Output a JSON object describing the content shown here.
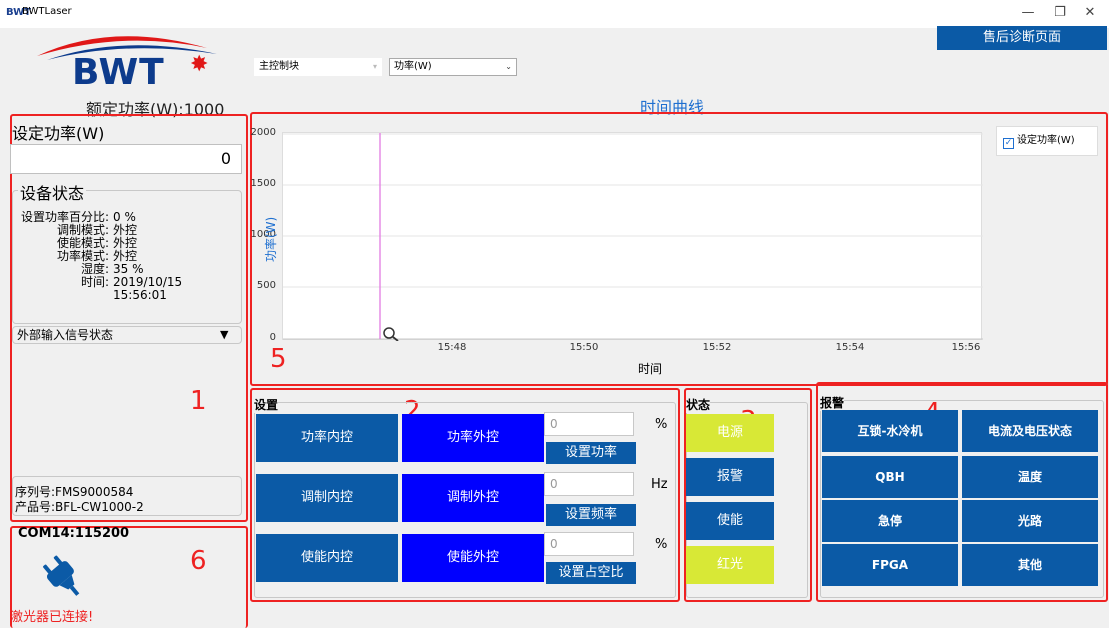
{
  "titlebar": {
    "app_name": "BWTLaser",
    "icon_text": "BWT",
    "minimize": "—",
    "restore": "❐",
    "close": "✕"
  },
  "header": {
    "service_button": "售后诊断页面",
    "logo_text": "BWT",
    "rated_power": "额定功率(W):1000",
    "module_combo": "主控制块",
    "param_combo": "功率(W)"
  },
  "left_panel": {
    "set_power_label": "设定功率(W)",
    "set_power_value": "0",
    "status_group_title": "设备状态",
    "status_items": [
      {
        "label": "设置功率百分比:",
        "value": "0 %"
      },
      {
        "label": "调制模式:",
        "value": "外控"
      },
      {
        "label": "使能模式:",
        "value": "外控"
      },
      {
        "label": "功率模式:",
        "value": "外控"
      },
      {
        "label": "湿度:",
        "value": "35 %"
      },
      {
        "label": "时间:",
        "value": "2019/10/15"
      },
      {
        "label": "",
        "value": "15:56:01"
      }
    ],
    "ext_signal": "外部输入信号状态",
    "serial_no": "序列号:FMS9000584",
    "product_no": "产品号:BFL-CW1000-2"
  },
  "connection": {
    "com": "COM14:115200",
    "status": "激光器已连接!"
  },
  "frame_numbers": [
    "1",
    "2",
    "3",
    "4",
    "5",
    "6"
  ],
  "chart_data": {
    "type": "line",
    "title": "时间曲线",
    "xlabel": "时间",
    "ylabel": "功率(W)",
    "ylim": [
      0,
      2000
    ],
    "yticks": [
      "2000",
      "1500",
      "1000",
      "500",
      "0"
    ],
    "xticks": [
      "15:48",
      "15:50",
      "15:52",
      "15:54",
      "15:56"
    ],
    "series": [
      {
        "name": "设定功率(W)",
        "values": [],
        "color": "#e070e0"
      }
    ],
    "legend": "top-right",
    "grid": true
  },
  "settings": {
    "title": "设置",
    "rows": [
      {
        "inner": "功率内控",
        "outer": "功率外控",
        "value": "0",
        "unit": "%",
        "apply": "设置功率"
      },
      {
        "inner": "调制内控",
        "outer": "调制外控",
        "value": "0",
        "unit": "Hz",
        "apply": "设置频率"
      },
      {
        "inner": "使能内控",
        "outer": "使能外控",
        "value": "0",
        "unit": "%",
        "apply": "设置占空比"
      }
    ]
  },
  "status_panel": {
    "title": "状态",
    "items": [
      {
        "label": "电源",
        "color": "#d8e836"
      },
      {
        "label": "报警",
        "color": "#0b5aa6"
      },
      {
        "label": "使能",
        "color": "#0b5aa6"
      },
      {
        "label": "红光",
        "color": "#d8e836"
      }
    ]
  },
  "alarm_panel": {
    "title": "报警",
    "items": [
      "互锁-水冷机",
      "电流及电压状态",
      "QBH",
      "温度",
      "急停",
      "光路",
      "FPGA",
      "其他"
    ]
  },
  "colors": {
    "accent_blue": "#0b5aa6",
    "bright_blue": "#0000ff",
    "indicator_yellow": "#d8e836",
    "frame_red": "#ee2222"
  }
}
